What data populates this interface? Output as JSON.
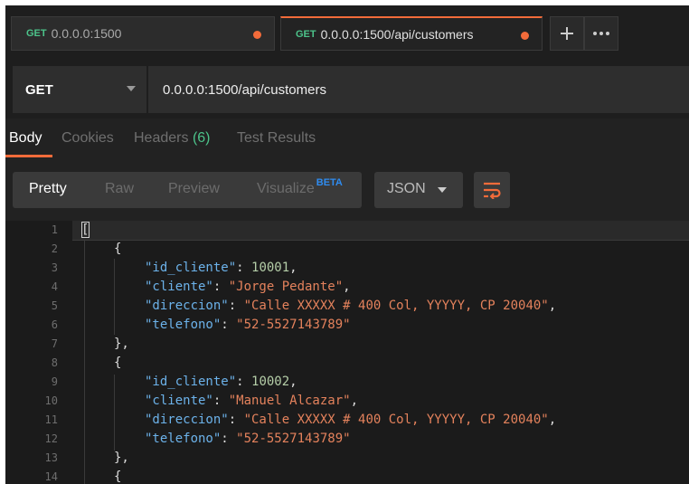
{
  "tabs": [
    {
      "method": "GET",
      "url": "0.0.0.0:1500"
    },
    {
      "method": "GET",
      "url": "0.0.0.0:1500/api/customers"
    }
  ],
  "request": {
    "method": "GET",
    "url": "0.0.0.0:1500/api/customers"
  },
  "response_tabs": {
    "body": "Body",
    "cookies": "Cookies",
    "headers": "Headers",
    "headers_count": "(6)",
    "test_results": "Test Results"
  },
  "format": {
    "pretty": "Pretty",
    "raw": "Raw",
    "preview": "Preview",
    "visualize": "Visualize",
    "beta": "BETA",
    "language": "JSON"
  },
  "icons": {
    "new_tab": "plus-icon",
    "more": "more-icon",
    "wrap": "wrap-lines-icon",
    "dropdown": "chevron-down-icon"
  },
  "colors": {
    "accent": "#f26b3a",
    "method_green": "#4cc38a",
    "json_key": "#6cb2ea",
    "json_string": "#e4825c",
    "json_number": "#b5cea8"
  },
  "code": {
    "line_numbers": [
      "1",
      "2",
      "3",
      "4",
      "5",
      "6",
      "7",
      "8",
      "9",
      "10",
      "11",
      "12",
      "13",
      "14"
    ],
    "open_bracket": "[",
    "open_brace": "{",
    "close_brace_comma": "},",
    "comma": ",",
    "colon": ": ",
    "customers": [
      {
        "k1": "\"id_cliente\"",
        "v1": "10001",
        "k2": "\"cliente\"",
        "v2": "\"Jorge Pedante\"",
        "k3": "\"direccion\"",
        "v3": "\"Calle XXXXX # 400 Col, YYYYY, CP 20040\"",
        "k4": "\"telefono\"",
        "v4": "\"52-5527143789\""
      },
      {
        "k1": "\"id_cliente\"",
        "v1": "10002",
        "k2": "\"cliente\"",
        "v2": "\"Manuel Alcazar\"",
        "k3": "\"direccion\"",
        "v3": "\"Calle XXXXX # 400 Col, YYYYY, CP 20040\"",
        "k4": "\"telefono\"",
        "v4": "\"52-5527143789\""
      }
    ]
  }
}
